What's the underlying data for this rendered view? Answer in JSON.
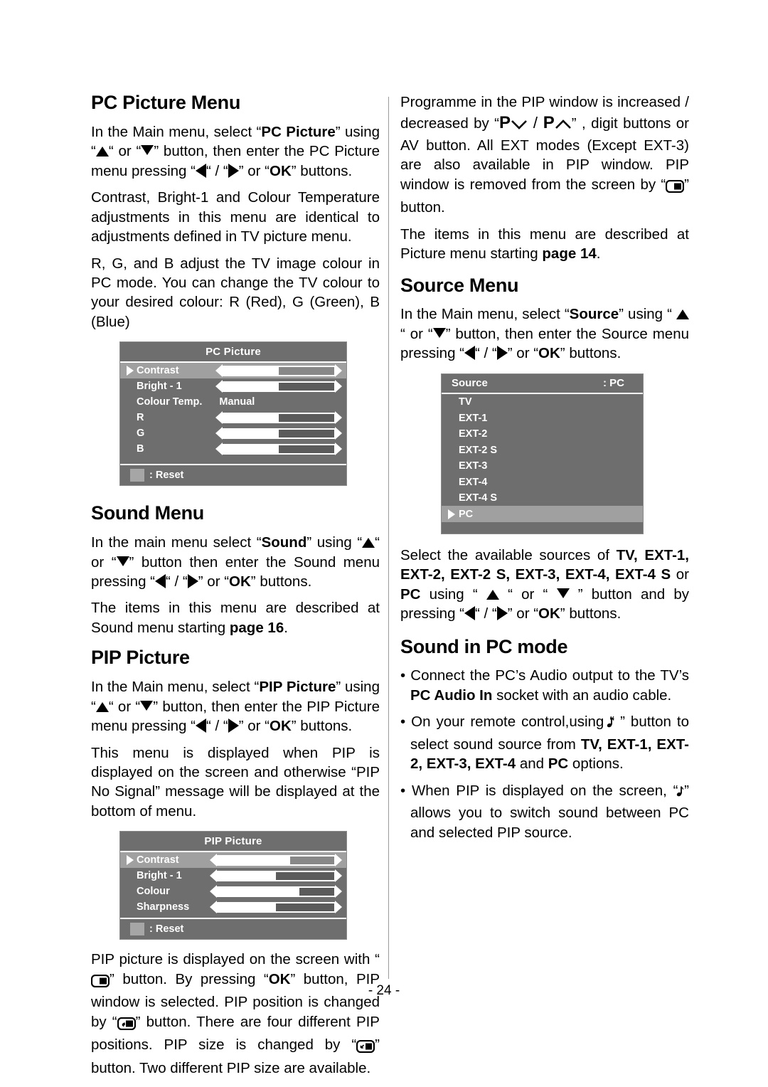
{
  "page": {
    "number_label": "- 24 -"
  },
  "left_column": {
    "sections": [
      {
        "heading": "PC Picture Menu",
        "paragraphs": [
          "In the Main menu, select “PC Picture” using “▲“ or “▼” button, then enter the PC Picture menu pressing “◀“ / “▶” or “OK” buttons.",
          "Contrast, Bright-1 and Colour Temperature adjustments in this menu  are identical to adjustments defined in TV picture menu.",
          "R, G, and B adjust the TV image colour in PC mode. You can change the TV colour to your desired colour: R (Red), G (Green), B (Blue)"
        ]
      },
      {
        "heading": "Sound Menu",
        "paragraphs": [
          "In the main menu select “Sound” using “▲“ or “▼” button then enter the Sound menu pressing “◀“ / “▶” or “OK” buttons.",
          "The items in this menu are described at Sound menu starting page 16."
        ]
      },
      {
        "heading": "PIP Picture",
        "paragraphs": [
          "In the Main menu, select “PIP Picture” using “▲“ or “▼” button, then enter the PIP Picture menu pressing “◀“ / “▶” or “OK” buttons.",
          "This menu is displayed when PIP is displayed on the screen and otherwise “PIP No Signal” message will be displayed at the bottom of menu.",
          "PIP picture is displayed on the screen with “□” button. By pressing “OK” button, PIP window is selected. PIP position is changed by “□” button. There are four different PIP positions. PIP size is changed by “□” button. Two different PIP size are available."
        ]
      }
    ]
  },
  "right_column": {
    "intro_paragraphs": [
      "Programme in the PIP window is increased / decreased by “P∨ / P∧” , digit buttons or AV button. All EXT modes (Except EXT-3) are also available in PIP window. PIP window is removed from the screen by “□” button.",
      "The items in this menu are described at Picture menu starting page 14."
    ],
    "sections": [
      {
        "heading": "Source Menu",
        "paragraphs": [
          "In the Main menu, select “Source” using “▲“ or “▼” button, then enter the Source menu pressing “◀“ / “▶” or “OK” buttons.",
          "Select the available sources of TV, EXT-1, EXT-2, EXT-2 S, EXT-3, EXT-4, EXT-4 S or PC using “▲“ or “▼” button and by pressing “◀“ / “▶” or “OK” buttons."
        ]
      },
      {
        "heading": "Sound in PC mode",
        "bullets": [
          "Connect the PC’s Audio output to the TV’s PC Audio In socket with an audio cable.",
          "On your remote control,using “♪ ” button to select sound source from TV, EXT-1, EXT-2, EXT-3, EXT-4 and PC  options.",
          "When PIP is displayed on the screen, “ ♪” allows you to switch sound between PC and selected PIP source."
        ]
      }
    ]
  },
  "osd_pc_picture": {
    "title": "PC Picture",
    "rows": [
      {
        "label": "Contrast",
        "type": "slider",
        "fill_percent": 50,
        "selected": true
      },
      {
        "label": "Bright - 1",
        "type": "slider",
        "fill_percent": 50,
        "selected": false
      },
      {
        "label": "Colour Temp.",
        "type": "value",
        "value": "Manual",
        "selected": false
      },
      {
        "label": "R",
        "type": "slider",
        "fill_percent": 50,
        "selected": false
      },
      {
        "label": "G",
        "type": "slider",
        "fill_percent": 50,
        "selected": false
      },
      {
        "label": "B",
        "type": "slider",
        "fill_percent": 50,
        "selected": false
      }
    ],
    "footer_label": ": Reset"
  },
  "osd_pip_picture": {
    "title": "PIP Picture",
    "rows": [
      {
        "label": "Contrast",
        "type": "slider",
        "fill_percent": 62,
        "selected": true
      },
      {
        "label": "Bright - 1",
        "type": "slider",
        "fill_percent": 50,
        "selected": false
      },
      {
        "label": "Colour",
        "type": "slider",
        "fill_percent": 70,
        "selected": false
      },
      {
        "label": "Sharpness",
        "type": "slider",
        "fill_percent": 50,
        "selected": false
      }
    ],
    "footer_label": ": Reset"
  },
  "osd_source": {
    "title": "Source",
    "current_value": ": PC",
    "items": [
      {
        "label": "TV",
        "selected": false
      },
      {
        "label": "EXT-1",
        "selected": false
      },
      {
        "label": "EXT-2",
        "selected": false
      },
      {
        "label": "EXT-2 S",
        "selected": false
      },
      {
        "label": "EXT-3",
        "selected": false
      },
      {
        "label": "EXT-4",
        "selected": false
      },
      {
        "label": "EXT-4 S",
        "selected": false
      },
      {
        "label": "PC",
        "selected": true
      }
    ]
  },
  "colors": {
    "osd_background": "#6e6e6e",
    "osd_selected": "#a0a0a0",
    "osd_track_empty": "#5b5b5b",
    "osd_fill": "#ffffff",
    "page_background": "#ffffff",
    "text": "#000000"
  }
}
